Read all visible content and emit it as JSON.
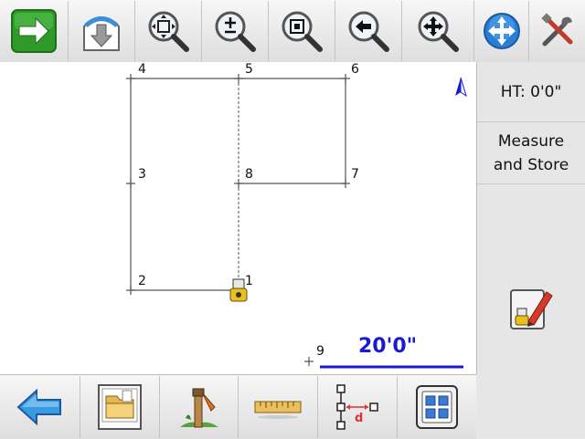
{
  "toolbar": {
    "buttons": [
      {
        "name": "next-arrow-icon"
      },
      {
        "name": "download-map-icon"
      },
      {
        "name": "zoom-extents-icon"
      },
      {
        "name": "zoom-in-out-icon"
      },
      {
        "name": "zoom-window-icon"
      },
      {
        "name": "zoom-previous-icon"
      },
      {
        "name": "pan-icon"
      },
      {
        "name": "compass-pan-icon"
      },
      {
        "name": "tools-icon"
      }
    ]
  },
  "map": {
    "points": [
      {
        "id": "1",
        "label": "1"
      },
      {
        "id": "2",
        "label": "2"
      },
      {
        "id": "3",
        "label": "3"
      },
      {
        "id": "4",
        "label": "4"
      },
      {
        "id": "5",
        "label": "5"
      },
      {
        "id": "6",
        "label": "6"
      },
      {
        "id": "7",
        "label": "7"
      },
      {
        "id": "8",
        "label": "8"
      },
      {
        "id": "9",
        "label": "9"
      }
    ],
    "scale_label": "20'0\"",
    "north_color": "#1a1ad6"
  },
  "side": {
    "ht_label": "HT: 0'0\"",
    "measure_line1": "Measure",
    "measure_line2": "and Store"
  },
  "bottom": {
    "buttons": [
      {
        "name": "back-arrow-icon"
      },
      {
        "name": "folder-icon"
      },
      {
        "name": "survey-stake-icon"
      },
      {
        "name": "ruler-icon"
      },
      {
        "name": "distance-offset-icon"
      },
      {
        "name": "grid-layout-icon"
      }
    ],
    "offset_letter": "d"
  },
  "colors": {
    "accent_blue": "#1a1ad6",
    "line_red": "#e03030"
  }
}
